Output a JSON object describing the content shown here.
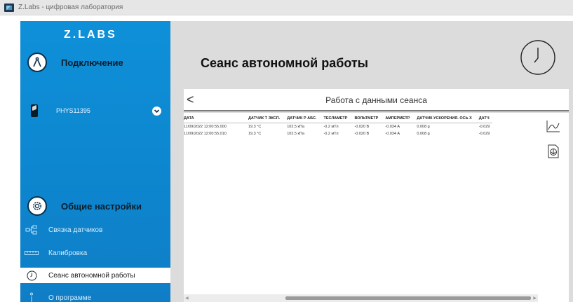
{
  "window": {
    "title": "Z.Labs - цифровая лаборатория"
  },
  "sidebar": {
    "logo": "Z.LABS",
    "connection": {
      "title": "Подключение",
      "device_name": "PHYS11395"
    },
    "settings": {
      "title": "Общие настройки",
      "items": [
        {
          "label": "Связка датчиков",
          "icon": "sensor-link-icon"
        },
        {
          "label": "Калибровка",
          "icon": "ruler-icon"
        },
        {
          "label": "Сеанс автономной работы",
          "icon": "clock-icon",
          "active": true
        },
        {
          "label": "О программе",
          "icon": "info-icon"
        }
      ]
    }
  },
  "main": {
    "title": "Сеанс автономной работы",
    "subtitle": "Работа с данными сеанса",
    "back_label": "<"
  },
  "table": {
    "headers": [
      "ДАТА",
      "ДАТЧИК Т ЭКСП.",
      "ДАТЧИК Р АБС.",
      "ТЕСЛАМЕТР",
      "ВОЛЬТМЕТР",
      "АМПЕРМЕТР",
      "ДАТЧИК УСКОРЕНИЯ. ОСЬ Х",
      "ДАТЧ"
    ],
    "rows": [
      [
        "11/09/2022 12:00:55.000",
        "19.3 °C",
        "102.5 кПа",
        "-0.2 мТл",
        "-0.020 В",
        "-0.034 А",
        "0.008 g",
        "-0.029"
      ],
      [
        "11/09/2022 12:00:55.010",
        "19.3 °C",
        "102.5 кПа",
        "-0.2 мТл",
        "-0.020 В",
        "-0.034 А",
        "0.008 g",
        "-0.029"
      ]
    ]
  },
  "tools": [
    {
      "icon": "chart-icon"
    },
    {
      "icon": "download-icon"
    }
  ],
  "colors": {
    "sidebar": "#0e90d8",
    "accent_dark": "#0a2f4a",
    "background": "#dcdcdc"
  }
}
